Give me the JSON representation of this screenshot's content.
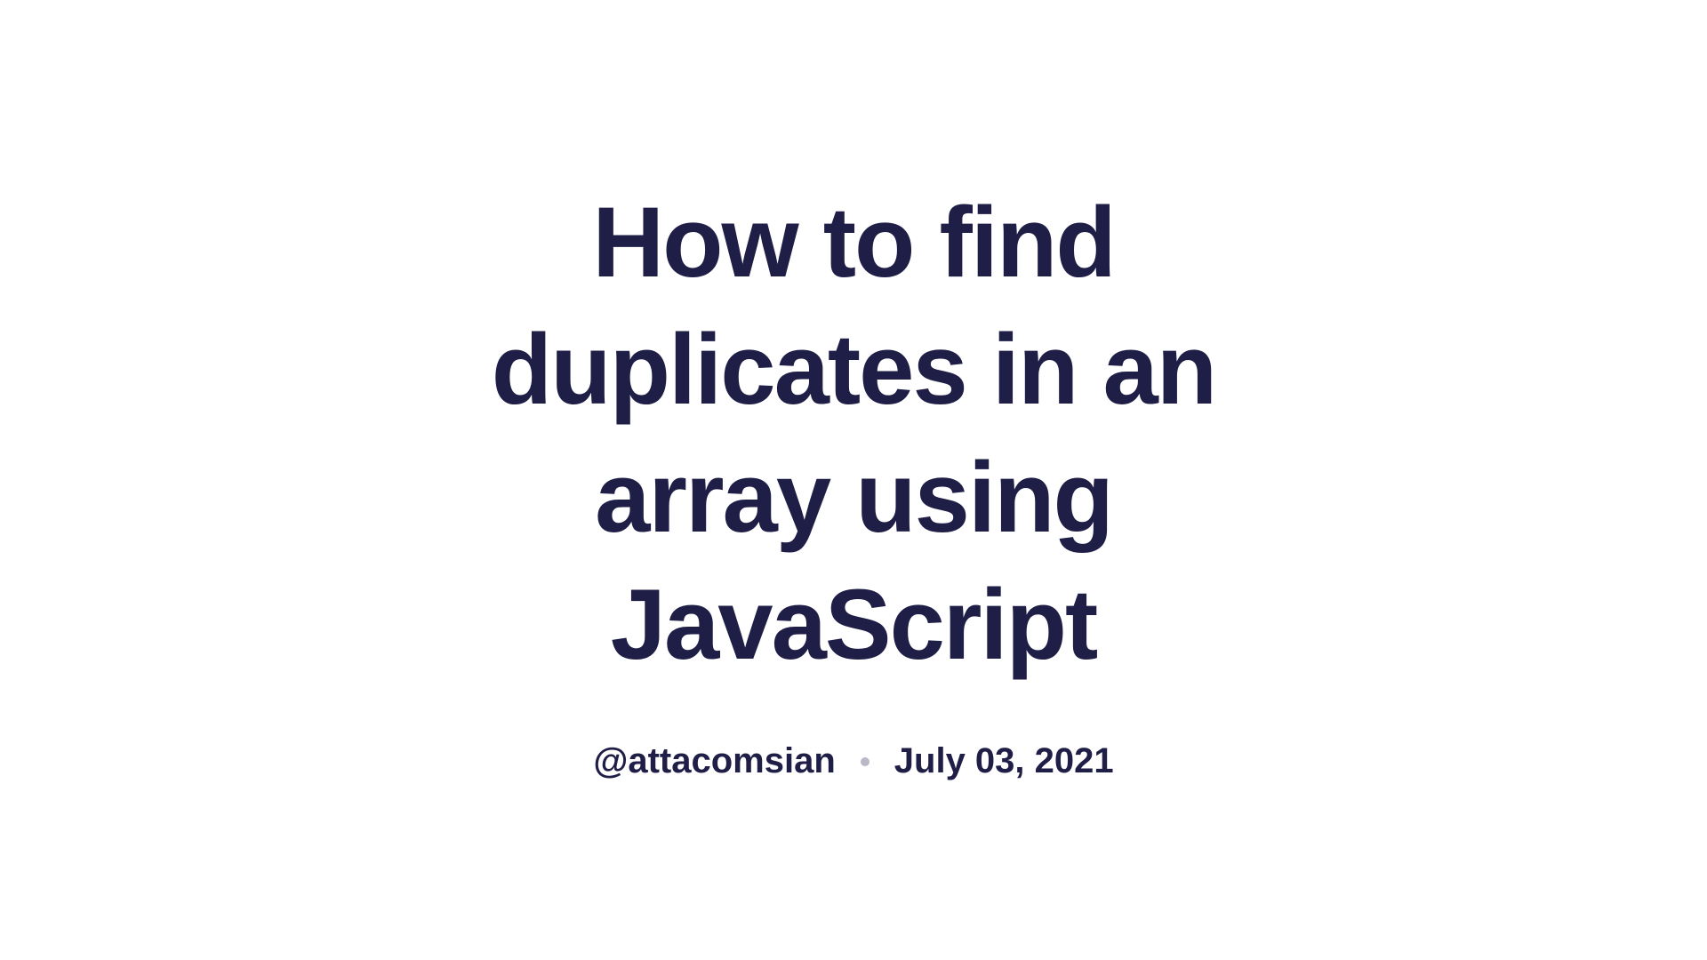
{
  "title": "How to find duplicates in an array using JavaScript",
  "author": "@attacomsian",
  "date": "July 03, 2021",
  "colors": {
    "text": "#1f1e47",
    "background": "#ffffff",
    "dot": "#b8b8c8"
  }
}
